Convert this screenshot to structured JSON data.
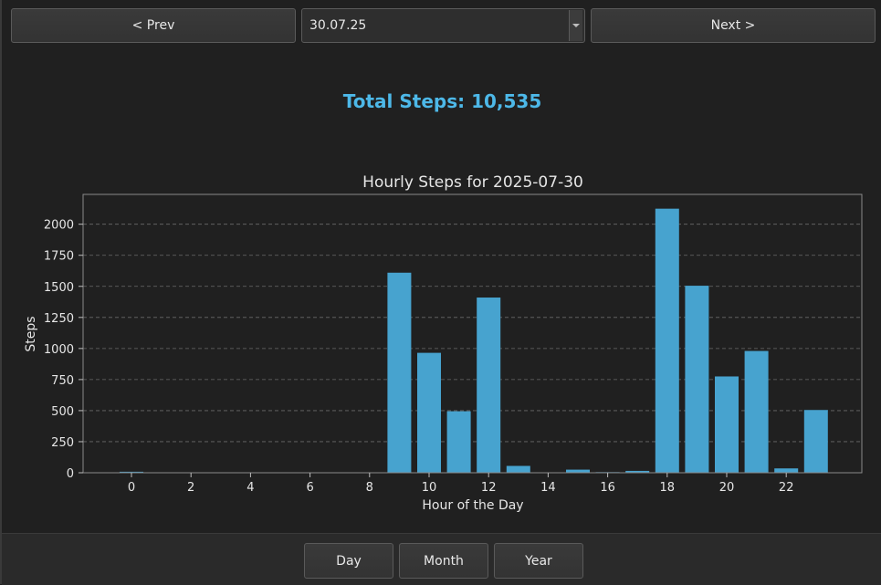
{
  "nav": {
    "prev_label": "< Prev",
    "next_label": "Next >",
    "date_value": "30.07.25"
  },
  "total_steps": "Total Steps: 10,535",
  "period_buttons": {
    "day": "Day",
    "month": "Month",
    "year": "Year"
  },
  "colors": {
    "accent": "#4db8e8",
    "bar": "#47a3cf",
    "background": "#202020"
  },
  "chart_data": {
    "type": "bar",
    "title": "Hourly Steps for 2025-07-30",
    "xlabel": "Hour of the Day",
    "ylabel": "Steps",
    "categories": [
      0,
      1,
      2,
      3,
      4,
      5,
      6,
      7,
      8,
      9,
      10,
      11,
      12,
      13,
      14,
      15,
      16,
      17,
      18,
      19,
      20,
      21,
      22,
      23
    ],
    "values": [
      8,
      0,
      0,
      0,
      0,
      0,
      0,
      0,
      0,
      1610,
      965,
      495,
      1410,
      55,
      0,
      25,
      5,
      15,
      2125,
      1505,
      775,
      980,
      35,
      505
    ],
    "xticks": [
      0,
      2,
      4,
      6,
      8,
      10,
      12,
      14,
      16,
      18,
      20,
      22
    ],
    "yticks": [
      0,
      250,
      500,
      750,
      1000,
      1250,
      1500,
      1750,
      2000
    ],
    "ylim": [
      0,
      2240
    ],
    "grid": "y-dashed"
  }
}
